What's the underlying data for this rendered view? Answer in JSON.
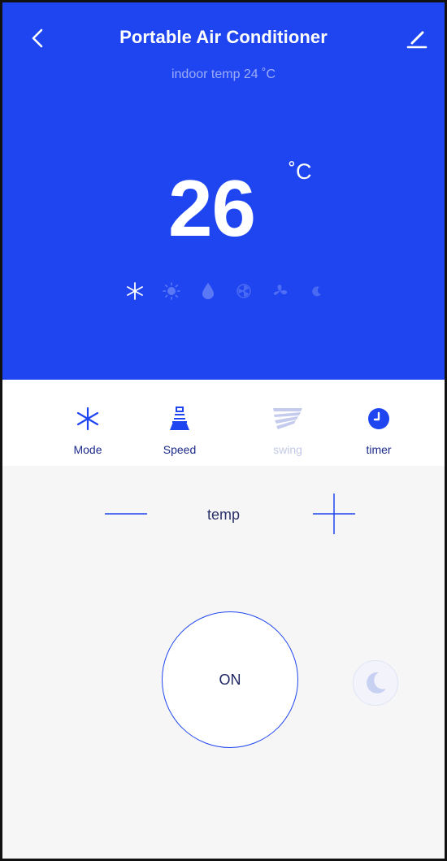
{
  "header": {
    "title": "Portable Air Conditioner",
    "subtitle": "indoor temp 24 ˚C"
  },
  "display": {
    "temperature": "26",
    "unit": "˚C",
    "modes": [
      {
        "icon": "snowflake-icon",
        "active": true
      },
      {
        "icon": "sun-icon",
        "active": false
      },
      {
        "icon": "drop-icon",
        "active": false
      },
      {
        "icon": "radiation-icon",
        "active": false
      },
      {
        "icon": "fan-icon",
        "active": false
      },
      {
        "icon": "moon-icon",
        "active": false
      }
    ]
  },
  "controls": [
    {
      "label": "Mode",
      "icon": "snowflake-icon",
      "enabled": true
    },
    {
      "label": "Speed",
      "icon": "speed-icon",
      "enabled": true
    },
    {
      "label": "swing",
      "icon": "swing-icon",
      "enabled": false
    },
    {
      "label": "timer",
      "icon": "clock-icon",
      "enabled": true
    }
  ],
  "temp_control": {
    "label": "temp"
  },
  "power": {
    "label": "ON"
  },
  "colors": {
    "primary": "#1f45f0",
    "background": "#f6f6f6",
    "label_text": "#1b2a8a",
    "disabled": "#c2c9e6"
  }
}
